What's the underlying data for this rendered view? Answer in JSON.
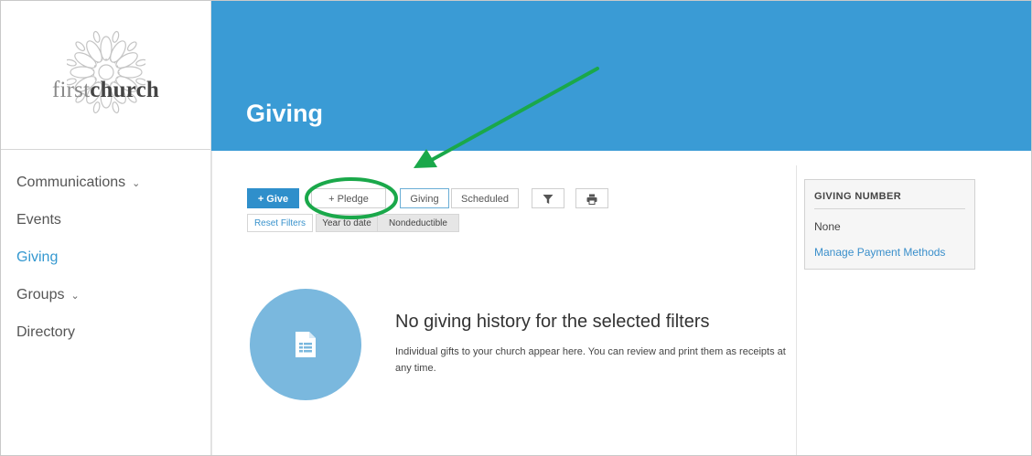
{
  "logo": {
    "prefix": "first",
    "bold": "church"
  },
  "sidebar": {
    "items": [
      {
        "label": "Communications",
        "has_chevron": true,
        "active": false
      },
      {
        "label": "Events",
        "has_chevron": false,
        "active": false
      },
      {
        "label": "Giving",
        "has_chevron": false,
        "active": true
      },
      {
        "label": "Groups",
        "has_chevron": true,
        "active": false
      },
      {
        "label": "Directory",
        "has_chevron": false,
        "active": false
      }
    ],
    "chevron_glyph": "⌄"
  },
  "header": {
    "title": "Giving"
  },
  "toolbar": {
    "give_label": "+ Give",
    "pledge_label": "+ Pledge",
    "tab_giving": "Giving",
    "tab_scheduled": "Scheduled",
    "filter_icon": "filter-icon",
    "print_icon": "print-icon"
  },
  "filters": {
    "reset": "Reset Filters",
    "year_to_date": "Year to date",
    "nondeductible": "Nondeductible"
  },
  "empty_state": {
    "title": "No giving history for the selected filters",
    "description": "Individual gifts to your church appear here. You can review and print them as receipts at any time.",
    "icon": "document-icon"
  },
  "giving_card": {
    "title": "GIVING NUMBER",
    "value": "None",
    "link": "Manage Payment Methods"
  },
  "colors": {
    "header": "#3a9bd5",
    "accent": "#2f8fcb",
    "circle": "#7ab8de",
    "annotation": "#1aa84a"
  }
}
